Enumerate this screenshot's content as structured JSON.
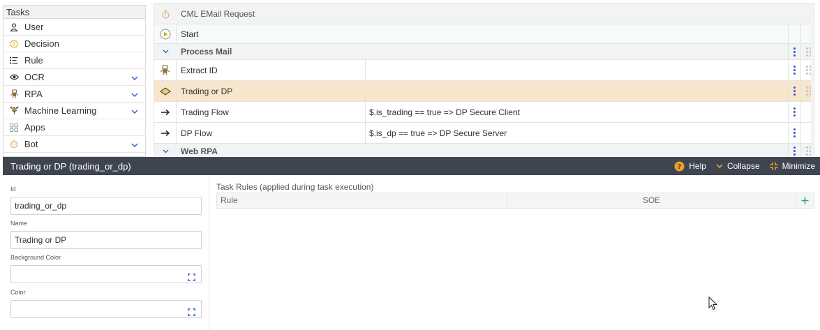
{
  "sidebar": {
    "title": "Tasks",
    "items": [
      {
        "label": "User",
        "icon": "user-icon",
        "expandable": false
      },
      {
        "label": "Decision",
        "icon": "decision-icon",
        "expandable": false
      },
      {
        "label": "Rule",
        "icon": "rule-icon",
        "expandable": false
      },
      {
        "label": "OCR",
        "icon": "eye-icon",
        "expandable": true
      },
      {
        "label": "RPA",
        "icon": "robot-icon",
        "expandable": true
      },
      {
        "label": "Machine Learning",
        "icon": "tree-icon",
        "expandable": true
      },
      {
        "label": "Apps",
        "icon": "apps-icon",
        "expandable": false
      },
      {
        "label": "Bot",
        "icon": "bot-icon",
        "expandable": true
      }
    ]
  },
  "grid": {
    "rows": [
      {
        "name": "CML EMail Request",
        "expr": "",
        "icon": "timer-icon",
        "kind": "header"
      },
      {
        "name": "Start",
        "expr": "",
        "icon": "play-icon",
        "kind": "start"
      },
      {
        "name": "Process Mail",
        "expr": "",
        "icon": "chevron-down-icon",
        "kind": "group"
      },
      {
        "name": "Extract ID",
        "expr": "",
        "icon": "robot-icon",
        "kind": "task"
      },
      {
        "name": "Trading or DP",
        "expr": "",
        "icon": "decision-diamond-icon",
        "kind": "selected"
      },
      {
        "name": "Trading Flow",
        "expr": "$.is_trading == true => DP Secure Client",
        "icon": "arrow-right-icon",
        "kind": "flow"
      },
      {
        "name": "DP Flow",
        "expr": "$.is_dp == true => DP Secure Server",
        "icon": "arrow-right-icon",
        "kind": "flow"
      },
      {
        "name": "Web RPA",
        "expr": "",
        "icon": "chevron-down-icon",
        "kind": "group"
      }
    ]
  },
  "panel": {
    "title": "Trading or DP (trading_or_dp)",
    "help_label": "Help",
    "collapse_label": "Collapse",
    "minimize_label": "Minimize"
  },
  "form": {
    "id_label": "Id",
    "id_value": "trading_or_dp",
    "name_label": "Name",
    "name_value": "Trading or DP",
    "bg_color_label": "Background Color",
    "bg_color_value": "",
    "color_label": "Color",
    "color_value": ""
  },
  "rules": {
    "title": "Task Rules (applied during task execution)",
    "col_rule": "Rule",
    "col_soe": "SOE"
  },
  "colors": {
    "panel_bar": "#3f4451",
    "selected_row": "#f7e6cc",
    "accent_blue": "#2b5cc7",
    "add_green": "#3aa655",
    "help_orange": "#f0a020"
  }
}
